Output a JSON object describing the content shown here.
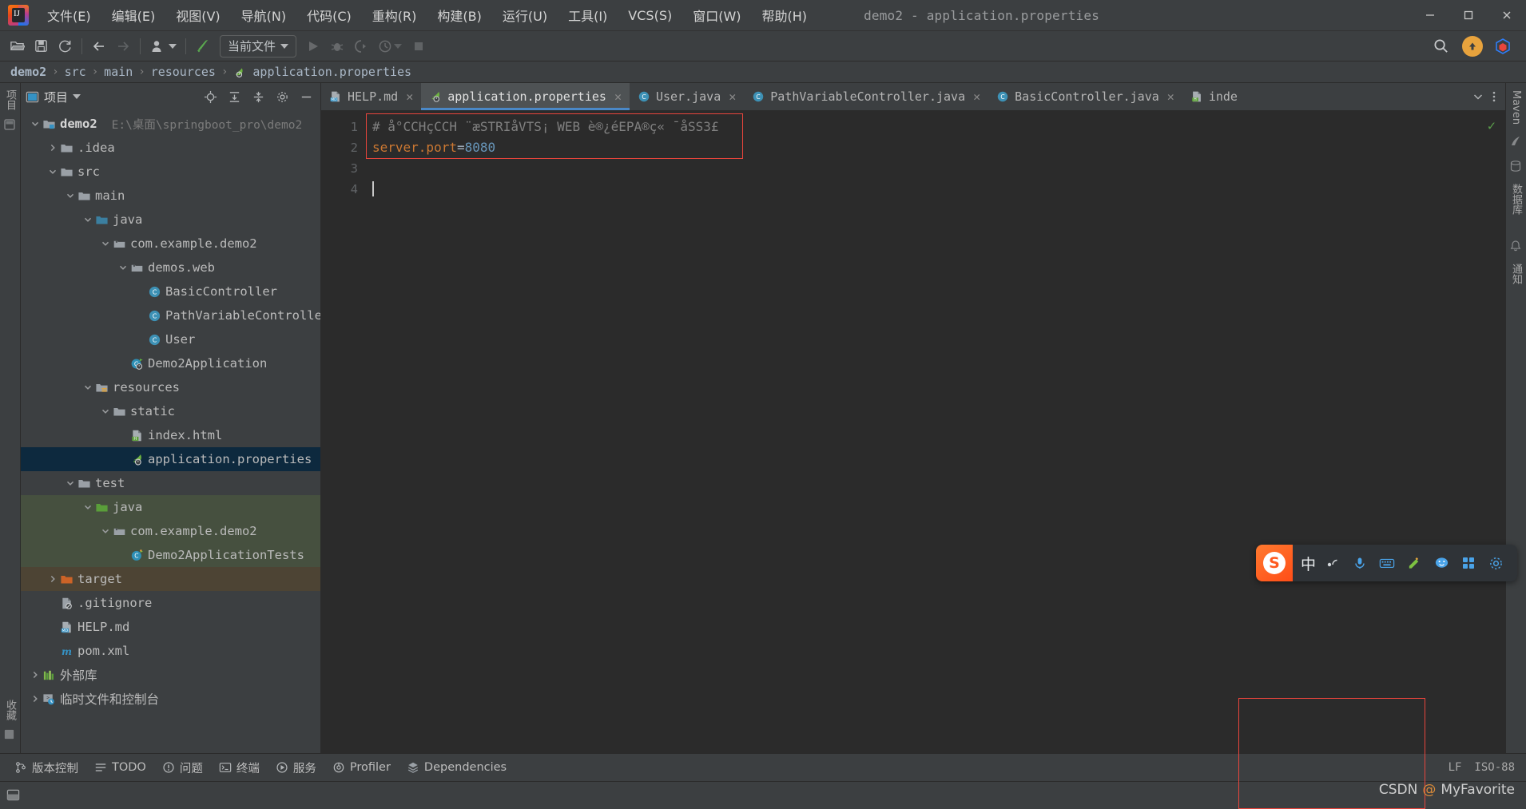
{
  "window": {
    "title": "demo2 - application.properties",
    "minimize": "—",
    "maximize": "☐",
    "close": "✕"
  },
  "menubar": {
    "items": [
      {
        "label": "文件(E)",
        "name": "menu-file"
      },
      {
        "label": "编辑(E)",
        "name": "menu-edit"
      },
      {
        "label": "视图(V)",
        "name": "menu-view"
      },
      {
        "label": "导航(N)",
        "name": "menu-navigate"
      },
      {
        "label": "代码(C)",
        "name": "menu-code"
      },
      {
        "label": "重构(R)",
        "name": "menu-refactor"
      },
      {
        "label": "构建(B)",
        "name": "menu-build"
      },
      {
        "label": "运行(U)",
        "name": "menu-run"
      },
      {
        "label": "工具(I)",
        "name": "menu-tools"
      },
      {
        "label": "VCS(S)",
        "name": "menu-vcs"
      },
      {
        "label": "窗口(W)",
        "name": "menu-window"
      },
      {
        "label": "帮助(H)",
        "name": "menu-help"
      }
    ]
  },
  "toolbar": {
    "run_config": "当前文件",
    "icons": [
      "open-folder-icon",
      "save-icon",
      "sync-icon",
      "back-arrow-icon",
      "forward-arrow-icon",
      "user-dropdown-icon",
      "build-hammer-icon"
    ],
    "run_controls": [
      "run-icon",
      "debug-icon",
      "run-coverage-icon",
      "profiler-icon",
      "stop-icon"
    ],
    "right_icons": [
      "search-icon",
      "update-icon",
      "ide-services-icon"
    ]
  },
  "breadcrumb": {
    "items": [
      "demo2",
      "src",
      "main",
      "resources",
      "application.properties"
    ],
    "separator": "›"
  },
  "left_rail": {
    "top_labels": [
      "项目"
    ],
    "bottom_labels": [
      "收藏"
    ]
  },
  "right_rail": {
    "labels": [
      "Maven",
      "数据库",
      "通知"
    ]
  },
  "project_panel": {
    "title": "项目",
    "header_icons": [
      "locate-icon",
      "expand-all-icon",
      "collapse-all-icon",
      "settings-gear-icon",
      "hide-icon"
    ],
    "tree": [
      {
        "depth": 0,
        "arrow": "down",
        "icon": "module-folder-icon",
        "label": "demo2",
        "bold": true,
        "path": "E:\\桌面\\springboot_pro\\demo2",
        "state": "normal"
      },
      {
        "depth": 1,
        "arrow": "right",
        "icon": "folder-icon",
        "label": ".idea",
        "state": "normal"
      },
      {
        "depth": 1,
        "arrow": "down",
        "icon": "folder-icon",
        "label": "src",
        "state": "normal"
      },
      {
        "depth": 2,
        "arrow": "down",
        "icon": "folder-icon",
        "label": "main",
        "state": "normal"
      },
      {
        "depth": 3,
        "arrow": "down",
        "icon": "source-root-icon",
        "label": "java",
        "state": "normal"
      },
      {
        "depth": 4,
        "arrow": "down",
        "icon": "package-icon",
        "label": "com.example.demo2",
        "state": "normal"
      },
      {
        "depth": 5,
        "arrow": "down",
        "icon": "package-icon",
        "label": "demos.web",
        "state": "normal"
      },
      {
        "depth": 6,
        "arrow": "none",
        "icon": "java-class-icon",
        "label": "BasicController",
        "state": "normal"
      },
      {
        "depth": 6,
        "arrow": "none",
        "icon": "java-class-icon",
        "label": "PathVariableController",
        "state": "normal"
      },
      {
        "depth": 6,
        "arrow": "none",
        "icon": "java-class-icon",
        "label": "User",
        "state": "normal"
      },
      {
        "depth": 5,
        "arrow": "none",
        "icon": "spring-boot-app-icon",
        "label": "Demo2Application",
        "state": "normal"
      },
      {
        "depth": 3,
        "arrow": "down",
        "icon": "resource-root-icon",
        "label": "resources",
        "state": "normal"
      },
      {
        "depth": 4,
        "arrow": "down",
        "icon": "folder-icon",
        "label": "static",
        "state": "normal"
      },
      {
        "depth": 5,
        "arrow": "none",
        "icon": "html-file-icon",
        "label": "index.html",
        "state": "normal"
      },
      {
        "depth": 5,
        "arrow": "none",
        "icon": "spring-properties-icon",
        "label": "application.properties",
        "state": "selected"
      },
      {
        "depth": 2,
        "arrow": "down",
        "icon": "folder-icon",
        "label": "test",
        "state": "normal"
      },
      {
        "depth": 3,
        "arrow": "down",
        "icon": "test-source-root-icon",
        "label": "java",
        "state": "test"
      },
      {
        "depth": 4,
        "arrow": "down",
        "icon": "package-icon",
        "label": "com.example.demo2",
        "state": "test"
      },
      {
        "depth": 5,
        "arrow": "none",
        "icon": "test-class-icon",
        "label": "Demo2ApplicationTests",
        "state": "test"
      },
      {
        "depth": 1,
        "arrow": "right",
        "icon": "excluded-folder-icon",
        "label": "target",
        "state": "target"
      },
      {
        "depth": 1,
        "arrow": "none",
        "icon": "gitignore-file-icon",
        "label": ".gitignore",
        "state": "normal"
      },
      {
        "depth": 1,
        "arrow": "none",
        "icon": "markdown-file-icon",
        "label": "HELP.md",
        "state": "normal"
      },
      {
        "depth": 1,
        "arrow": "none",
        "icon": "maven-pom-icon",
        "label": "pom.xml",
        "state": "normal"
      },
      {
        "depth": 0,
        "arrow": "right",
        "icon": "external-libraries-icon",
        "label": "外部库",
        "state": "normal"
      },
      {
        "depth": 0,
        "arrow": "right",
        "icon": "scratches-consoles-icon",
        "label": "临时文件和控制台",
        "state": "normal"
      }
    ]
  },
  "editor": {
    "tabs": [
      {
        "label": "HELP.md",
        "icon": "markdown-file-icon",
        "active": false
      },
      {
        "label": "application.properties",
        "icon": "spring-properties-icon",
        "active": true
      },
      {
        "label": "User.java",
        "icon": "java-class-icon",
        "active": false
      },
      {
        "label": "PathVariableController.java",
        "icon": "java-class-icon",
        "active": false
      },
      {
        "label": "BasicController.java",
        "icon": "java-class-icon",
        "active": false
      },
      {
        "label": "inde",
        "icon": "html-file-icon",
        "active": false
      }
    ],
    "tab_close_glyph": "✕",
    "gutter_lines": [
      "1",
      "2",
      "3",
      "4"
    ],
    "lines": [
      {
        "num": "1",
        "type": "comment",
        "text": "# å°CCHçCCH ¨æSTRIåVTS¡ WEB è®¿éEPA®ç« ¯åSS3£"
      },
      {
        "num": "2",
        "type": "property",
        "key": "server.port",
        "eq": "=",
        "value": "8080"
      },
      {
        "num": "3",
        "type": "empty",
        "text": ""
      },
      {
        "num": "4",
        "type": "caret",
        "text": ""
      }
    ],
    "inspection_status": "✓"
  },
  "status_bar": {
    "items": [
      {
        "label": "版本控制",
        "icon": "version-control-icon"
      },
      {
        "label": "TODO",
        "icon": "todo-icon"
      },
      {
        "label": "问题",
        "icon": "problems-icon"
      },
      {
        "label": "终端",
        "icon": "terminal-icon"
      },
      {
        "label": "服务",
        "icon": "services-icon"
      },
      {
        "label": "Profiler",
        "icon": "profiler-icon"
      },
      {
        "label": "Dependencies",
        "icon": "dependencies-icon"
      }
    ],
    "right": [
      "LF",
      "ISO-88"
    ]
  },
  "ime_bar": {
    "logo_letter": "S",
    "mode": "中",
    "icons": [
      "voice-input-icon",
      "mic-icon",
      "keyboard-icon",
      "handwriting-icon",
      "emoji-icon",
      "apps-icon",
      "settings-icon"
    ]
  },
  "watermark": {
    "left": "CSDN",
    "at": "@",
    "right": "MyFavorite"
  },
  "colors": {
    "accent_blue": "#4a88c7",
    "selection_blue": "#0d293e",
    "test_green": "#46503f",
    "target_brown": "#4d4434",
    "red_highlight": "#e8453c",
    "panel_bg": "#3c3f41",
    "editor_bg": "#2b2b2b",
    "text": "#bbbbbb",
    "comment_gray": "#808080",
    "property_orange": "#cc7832",
    "number_blue": "#6897bb"
  }
}
